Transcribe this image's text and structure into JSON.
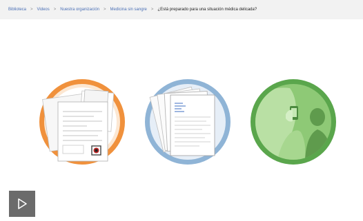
{
  "breadcrumb": {
    "items": [
      {
        "label": "Biblioteca"
      },
      {
        "label": "Videos"
      },
      {
        "label": "Nuestra organización"
      },
      {
        "label": "Medicina sin sangre"
      }
    ],
    "separator": ">",
    "current": "¿Está preparado para una situación médica delicada?"
  },
  "illustrations": [
    {
      "icon": "medical-documents-icon",
      "ring_color": "#f0913c"
    },
    {
      "icon": "paper-forms-icon",
      "ring_color": "#8fb4d6"
    },
    {
      "icon": "phone-call-icon",
      "ring_color": "#5aa64c"
    }
  ],
  "player": {
    "icon": "play-icon"
  }
}
